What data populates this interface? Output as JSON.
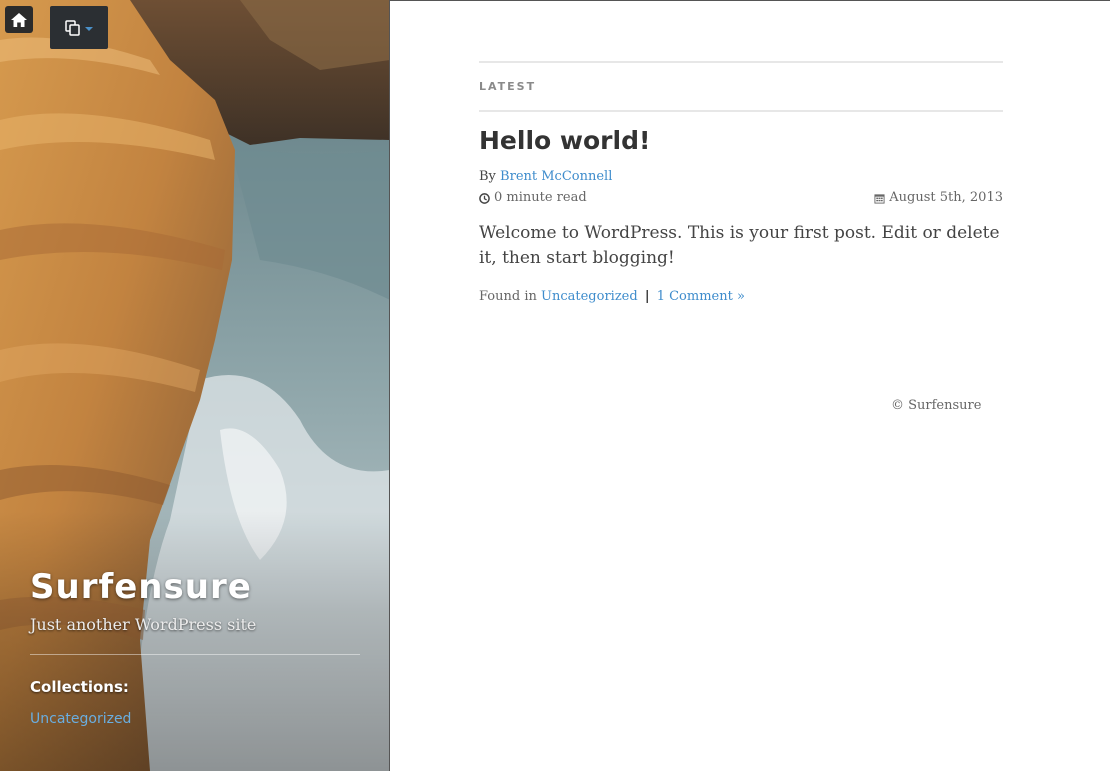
{
  "sidebar": {
    "site_title": "Surfensure",
    "tagline": "Just another WordPress site",
    "collections_heading": "Collections:",
    "collections": [
      {
        "label": "Uncategorized"
      }
    ]
  },
  "top_controls": {
    "home_icon": "home-icon",
    "menu_icon": "copy-icon"
  },
  "main": {
    "section_label": "LATEST",
    "post": {
      "title": "Hello world!",
      "by_prefix": "By",
      "author": "Brent McConnell",
      "read_time": "0 minute read",
      "date": "August 5th, 2013",
      "excerpt": "Welcome to WordPress. This is your first post. Edit or delete it, then start blogging!",
      "found_in_prefix": "Found in",
      "category": "Uncategorized",
      "separator": "|",
      "comments": "1 Comment »"
    }
  },
  "footer": {
    "copyright": "© Surfensure"
  },
  "colors": {
    "link": "#3e8ccc",
    "title_text": "#333333",
    "rule": "#e7e7e7"
  }
}
